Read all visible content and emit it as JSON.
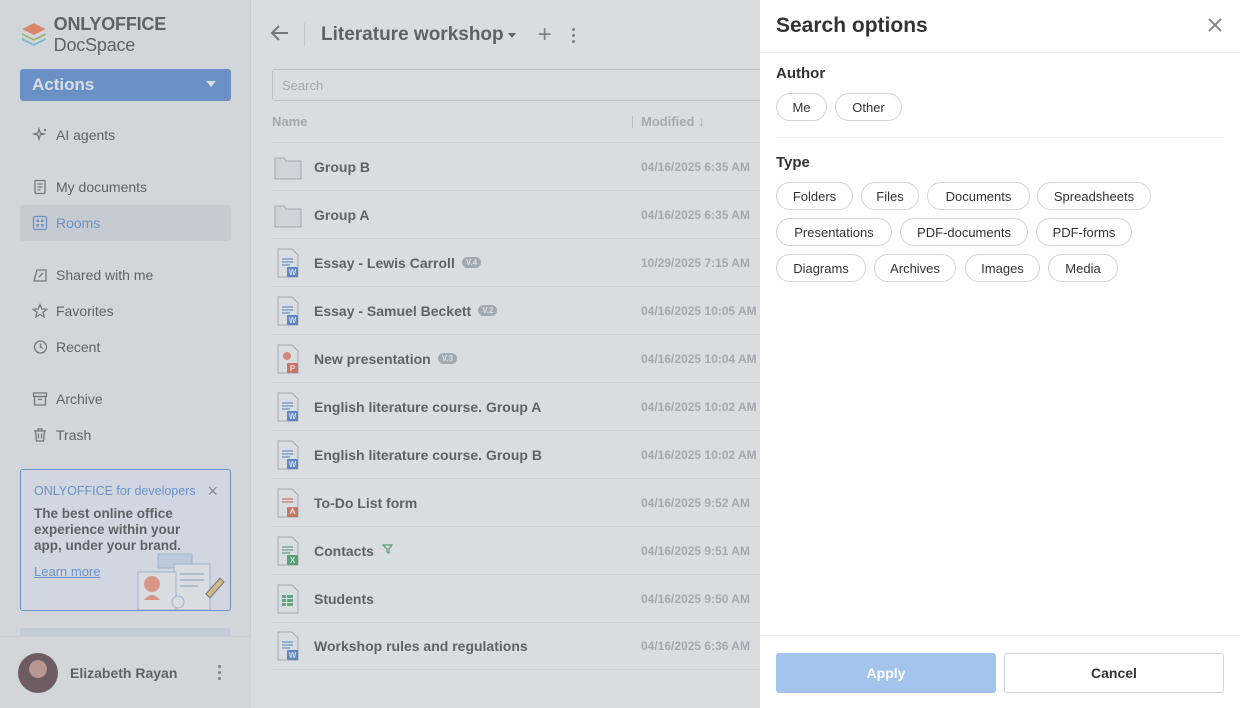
{
  "brand": {
    "name_bold": "ONLYOFFICE",
    "name_rest": "DocSpace"
  },
  "sidebar": {
    "actions_label": "Actions",
    "items": [
      {
        "label": "AI agents",
        "icon": "ai-agents-icon"
      },
      {
        "label": "My documents",
        "icon": "document-icon"
      },
      {
        "label": "Rooms",
        "icon": "rooms-icon",
        "active": true
      },
      {
        "label": "Shared with me",
        "icon": "shared-icon"
      },
      {
        "label": "Favorites",
        "icon": "star-icon"
      },
      {
        "label": "Recent",
        "icon": "recent-icon"
      },
      {
        "label": "Archive",
        "icon": "archive-icon"
      },
      {
        "label": "Trash",
        "icon": "trash-icon"
      }
    ],
    "promo": {
      "title": "ONLYOFFICE for developers",
      "body": "The best online office experience within your app, under your brand.",
      "link": "Learn more"
    },
    "user_name": "Elizabeth Rayan"
  },
  "main": {
    "room_title": "Literature workshop",
    "search_placeholder": "Search",
    "col_name": "Name",
    "col_modified": "Modified",
    "files": [
      {
        "name": "Group B",
        "type": "folder",
        "date": "04/16/2025 6:35 AM"
      },
      {
        "name": "Group A",
        "type": "folder",
        "date": "04/16/2025 6:35 AM"
      },
      {
        "name": "Essay - Lewis Carroll",
        "type": "word",
        "badge": "V.4",
        "date": "10/29/2025 7:15 AM"
      },
      {
        "name": "Essay - Samuel Beckett",
        "type": "word",
        "badge": "V.2",
        "date": "04/16/2025 10:05 AM"
      },
      {
        "name": "New presentation",
        "type": "slide",
        "badge": "V.3",
        "date": "04/16/2025 10:04 AM"
      },
      {
        "name": "English literature course. Group A",
        "type": "word",
        "date": "04/16/2025 10:02 AM"
      },
      {
        "name": "English literature course. Group B",
        "type": "word",
        "date": "04/16/2025 10:02 AM"
      },
      {
        "name": "To-Do List form",
        "type": "pdf",
        "date": "04/16/2025 9:52 AM"
      },
      {
        "name": "Contacts",
        "type": "sheet",
        "date": "04/16/2025 9:51 AM"
      },
      {
        "name": "Students",
        "type": "sheet-plain",
        "date": "04/16/2025 9:50 AM"
      },
      {
        "name": "Workshop rules and regulations",
        "type": "word",
        "date": "04/16/2025 6:36 AM"
      }
    ]
  },
  "panel": {
    "title": "Search options",
    "author_title": "Author",
    "author_tags": [
      "Me",
      "Other"
    ],
    "type_title": "Type",
    "type_tags": [
      "Folders",
      "Files",
      "Documents",
      "Spreadsheets",
      "Presentations",
      "PDF-documents",
      "PDF-forms",
      "Diagrams",
      "Archives",
      "Images",
      "Media"
    ],
    "apply_label": "Apply",
    "cancel_label": "Cancel"
  },
  "colors": {
    "accent": "#4781d1",
    "apply_disabled": "#a3c4ec"
  }
}
